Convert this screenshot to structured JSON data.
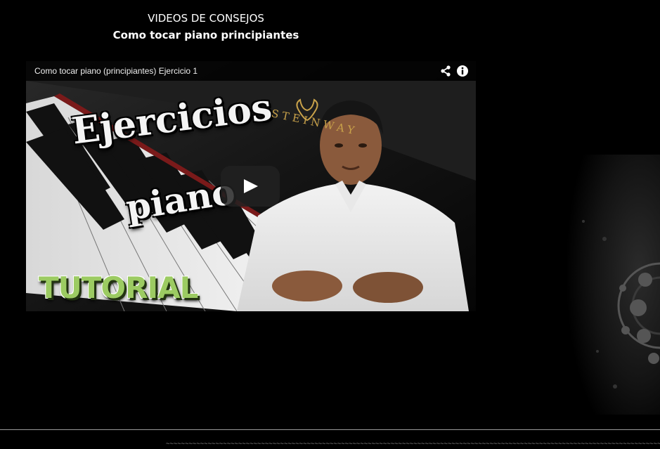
{
  "header": {
    "title": "VIDEOS DE CONSEJOS",
    "subtitle": "Como tocar piano principiantes"
  },
  "video": {
    "title": "Como tocar piano (principiantes) Ejercicio 1",
    "share_icon": "share-icon",
    "info_icon": "info-icon",
    "play_icon": "play-icon",
    "thumbnail": {
      "word_1": "Ejercicios",
      "word_2": "piano",
      "banner": "TUTORIAL",
      "brand": "STEINWAY"
    }
  },
  "footer": {
    "dashes": "~~~~~~~~~~~~~~~~~~~~~~~~~~~~~~~~~~~~~~~~~~~~~~~~~~~~~~~~~~~~~~~~~~~~~~~~~~~~~~~~~~~~~~~~~~~~~~~~~~~~~~~~~~~~~~~~~~~~~~~~~~~~~~~~~~~~~~~~~~~~~~~~"
  },
  "colors": {
    "background": "#000000",
    "tutorial_green": "#9ccb62",
    "divider": "#9a9a9a"
  }
}
